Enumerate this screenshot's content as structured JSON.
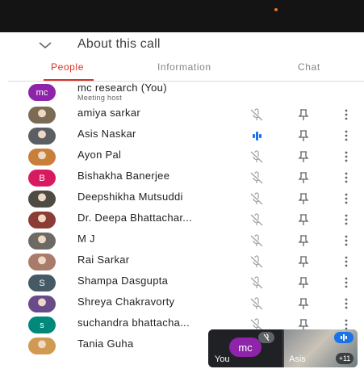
{
  "header": {
    "title": "About this call"
  },
  "tabs": [
    {
      "label": "People",
      "active": true
    },
    {
      "label": "Information",
      "active": false
    },
    {
      "label": "Chat",
      "active": false
    }
  ],
  "participants": [
    {
      "name": "mc research (You)",
      "subtitle": "Meeting host",
      "avatar_type": "initials",
      "initials": "mc",
      "color": "#8e24aa",
      "controls": false
    },
    {
      "name": "amiya sarkar",
      "avatar_type": "photo",
      "photo": "#7b6b55",
      "mic": "muted",
      "controls": true
    },
    {
      "name": "Asis Naskar",
      "avatar_type": "photo",
      "photo": "#5b5f63",
      "mic": "speaking",
      "controls": true
    },
    {
      "name": "Ayon Pal",
      "avatar_type": "photo",
      "photo": "#c77f3a",
      "mic": "muted",
      "controls": true
    },
    {
      "name": "Bishakha Banerjee",
      "avatar_type": "initials",
      "initials": "B",
      "color": "#d81b60",
      "mic": "muted",
      "controls": true
    },
    {
      "name": "Deepshikha Mutsuddi",
      "avatar_type": "photo",
      "photo": "#4e4a44",
      "mic": "muted",
      "controls": true
    },
    {
      "name": "Dr. Deepa Bhattachar...",
      "avatar_type": "photo",
      "photo": "#8b3d35",
      "mic": "muted",
      "controls": true
    },
    {
      "name": "M J",
      "avatar_type": "photo",
      "photo": "#6d6a66",
      "mic": "muted",
      "controls": true
    },
    {
      "name": "Rai Sarkar",
      "avatar_type": "photo",
      "photo": "#a97b6a",
      "mic": "muted",
      "controls": true
    },
    {
      "name": "Shampa Dasgupta",
      "avatar_type": "initials",
      "initials": "S",
      "color": "#455a64",
      "mic": "muted",
      "controls": true
    },
    {
      "name": "Shreya Chakravorty",
      "avatar_type": "photo",
      "photo": "#6a4b8a",
      "mic": "muted",
      "controls": true
    },
    {
      "name": "suchandra bhattacha...",
      "avatar_type": "initials",
      "initials": "s",
      "color": "#00897b",
      "mic": "muted",
      "controls": true
    },
    {
      "name": "Tania Guha",
      "avatar_type": "photo",
      "photo": "#d19a52",
      "mic": "none",
      "controls": false
    }
  ],
  "pip": {
    "self_initials": "mc",
    "self_label": "You",
    "other_label": "Asis",
    "overflow_count": "+11"
  },
  "colors": {
    "accent": "#d93025",
    "speaking": "#1a73e8",
    "icon": "#5f6368"
  },
  "icons": [
    "chevron-down-icon",
    "mic-off-icon",
    "speaking-icon",
    "pin-icon",
    "more-vert-icon"
  ]
}
